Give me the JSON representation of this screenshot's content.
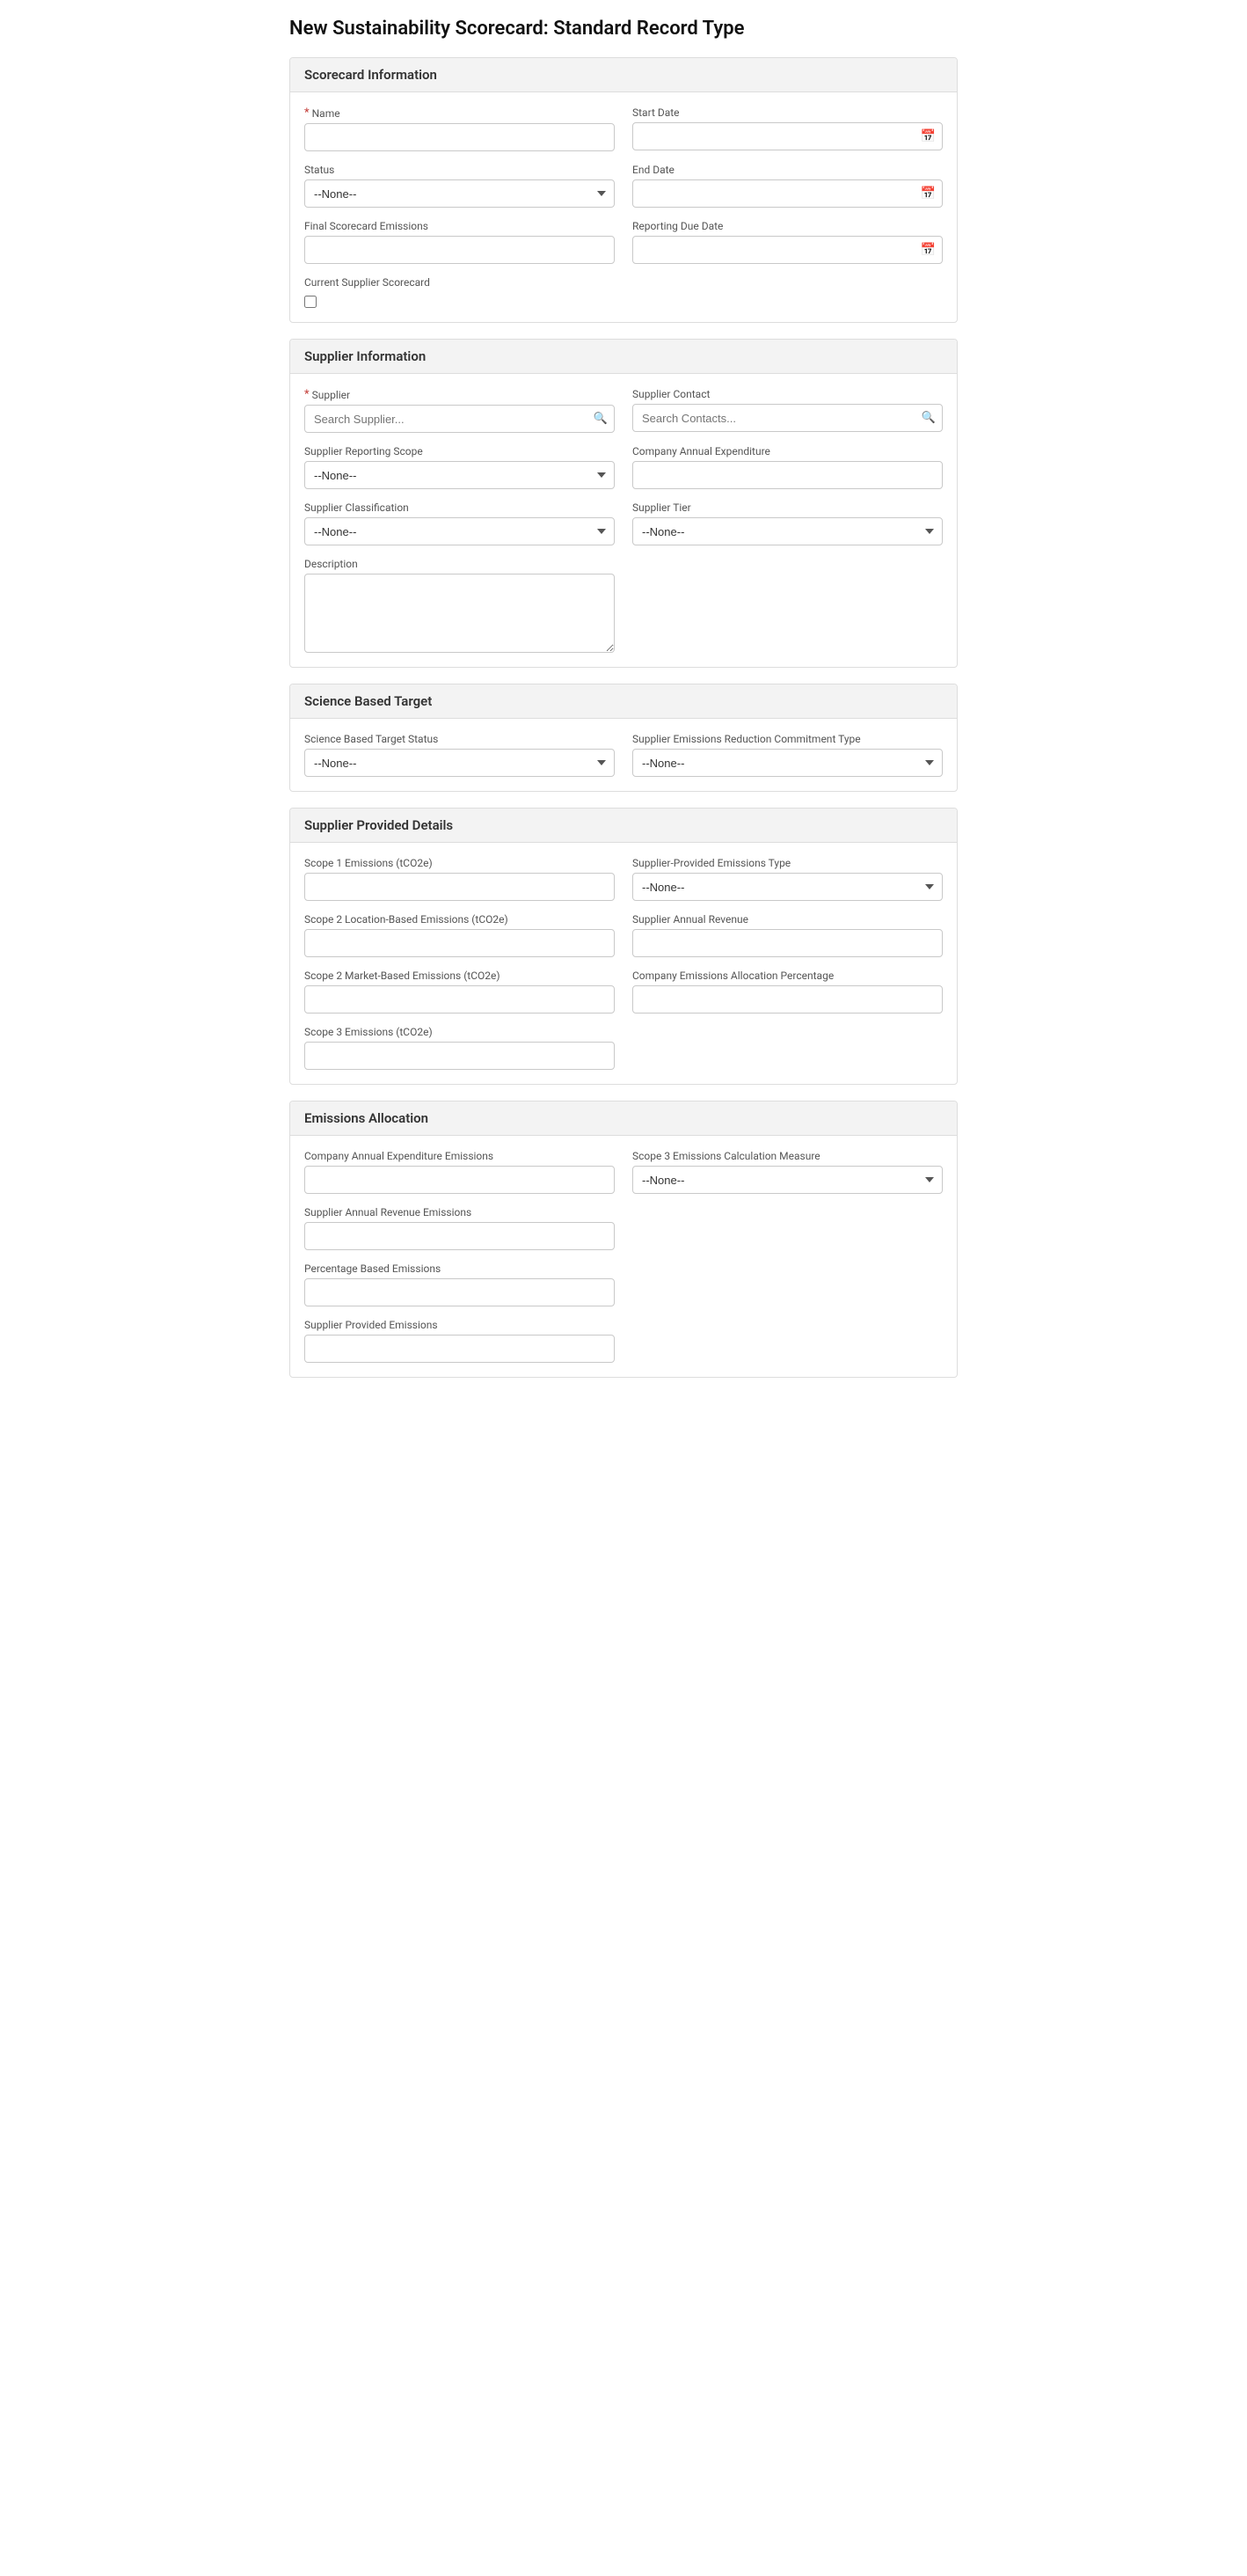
{
  "page": {
    "title": "New Sustainability Scorecard: Standard Record Type"
  },
  "sections": [
    {
      "id": "scorecard-information",
      "header": "Scorecard Information",
      "fields": [
        {
          "row": 1,
          "left": {
            "id": "name",
            "label": "Name",
            "type": "input",
            "required": true,
            "placeholder": ""
          },
          "right": {
            "id": "start-date",
            "label": "Start Date",
            "type": "date",
            "placeholder": ""
          }
        },
        {
          "row": 2,
          "left": {
            "id": "status",
            "label": "Status",
            "type": "select",
            "options": [
              "--None--"
            ],
            "value": "--None--"
          },
          "right": {
            "id": "end-date",
            "label": "End Date",
            "type": "date",
            "placeholder": ""
          }
        },
        {
          "row": 3,
          "left": {
            "id": "final-scorecard-emissions",
            "label": "Final Scorecard Emissions",
            "type": "input",
            "placeholder": ""
          },
          "right": {
            "id": "reporting-due-date",
            "label": "Reporting Due Date",
            "type": "date",
            "placeholder": ""
          }
        },
        {
          "row": 4,
          "left": {
            "id": "current-supplier-scorecard",
            "label": "Current Supplier Scorecard",
            "type": "checkbox"
          },
          "right": null
        }
      ]
    },
    {
      "id": "supplier-information",
      "header": "Supplier Information",
      "fields": [
        {
          "row": 1,
          "left": {
            "id": "supplier",
            "label": "Supplier",
            "type": "search",
            "required": true,
            "placeholder": "Search Supplier..."
          },
          "right": {
            "id": "supplier-contact",
            "label": "Supplier Contact",
            "type": "search",
            "placeholder": "Search Contacts..."
          }
        },
        {
          "row": 2,
          "left": {
            "id": "supplier-reporting-scope",
            "label": "Supplier Reporting Scope",
            "type": "select",
            "options": [
              "--None--"
            ],
            "value": "--None--"
          },
          "right": {
            "id": "company-annual-expenditure",
            "label": "Company Annual Expenditure",
            "type": "input",
            "placeholder": ""
          }
        },
        {
          "row": 3,
          "left": {
            "id": "supplier-classification",
            "label": "Supplier Classification",
            "type": "select",
            "options": [
              "--None--"
            ],
            "value": "--None--"
          },
          "right": {
            "id": "supplier-tier",
            "label": "Supplier Tier",
            "type": "select",
            "options": [
              "--None--"
            ],
            "value": "--None--"
          }
        },
        {
          "row": 4,
          "left": {
            "id": "description",
            "label": "Description",
            "type": "textarea",
            "placeholder": ""
          },
          "right": null
        }
      ]
    },
    {
      "id": "science-based-target",
      "header": "Science Based Target",
      "fields": [
        {
          "row": 1,
          "left": {
            "id": "science-based-target-status",
            "label": "Science Based Target Status",
            "type": "select",
            "options": [
              "--None--"
            ],
            "value": "--None--"
          },
          "right": {
            "id": "supplier-emissions-reduction-commitment-type",
            "label": "Supplier Emissions Reduction Commitment Type",
            "type": "select",
            "options": [
              "--None--"
            ],
            "value": "--None--"
          }
        }
      ]
    },
    {
      "id": "supplier-provided-details",
      "header": "Supplier Provided Details",
      "fields": [
        {
          "row": 1,
          "left": {
            "id": "scope-1-emissions",
            "label": "Scope 1 Emissions (tCO2e)",
            "type": "input",
            "placeholder": ""
          },
          "right": {
            "id": "supplier-provided-emissions-type",
            "label": "Supplier-Provided Emissions Type",
            "type": "select",
            "options": [
              "--None--"
            ],
            "value": "--None--"
          }
        },
        {
          "row": 2,
          "left": {
            "id": "scope-2-location-based-emissions",
            "label": "Scope 2 Location-Based Emissions (tCO2e)",
            "type": "input",
            "placeholder": ""
          },
          "right": {
            "id": "supplier-annual-revenue",
            "label": "Supplier Annual Revenue",
            "type": "input",
            "placeholder": ""
          }
        },
        {
          "row": 3,
          "left": {
            "id": "scope-2-market-based-emissions",
            "label": "Scope 2 Market-Based Emissions (tCO2e)",
            "type": "input",
            "placeholder": ""
          },
          "right": {
            "id": "company-emissions-allocation-percentage",
            "label": "Company Emissions Allocation Percentage",
            "type": "input",
            "placeholder": ""
          }
        },
        {
          "row": 4,
          "left": {
            "id": "scope-3-emissions",
            "label": "Scope 3 Emissions (tCO2e)",
            "type": "input",
            "placeholder": ""
          },
          "right": null
        }
      ]
    },
    {
      "id": "emissions-allocation",
      "header": "Emissions Allocation",
      "fields": [
        {
          "row": 1,
          "left": {
            "id": "company-annual-expenditure-emissions",
            "label": "Company Annual Expenditure Emissions",
            "type": "input",
            "placeholder": ""
          },
          "right": {
            "id": "scope-3-emissions-calculation-measure",
            "label": "Scope 3 Emissions Calculation Measure",
            "type": "select",
            "options": [
              "--None--"
            ],
            "value": "--None--"
          }
        },
        {
          "row": 2,
          "left": {
            "id": "supplier-annual-revenue-emissions",
            "label": "Supplier Annual Revenue Emissions",
            "type": "input",
            "placeholder": ""
          },
          "right": null
        },
        {
          "row": 3,
          "left": {
            "id": "percentage-based-emissions",
            "label": "Percentage Based Emissions",
            "type": "input",
            "placeholder": ""
          },
          "right": null
        },
        {
          "row": 4,
          "left": {
            "id": "supplier-provided-emissions",
            "label": "Supplier Provided Emissions",
            "type": "input",
            "placeholder": ""
          },
          "right": null
        }
      ]
    }
  ],
  "labels": {
    "none_option": "--None--",
    "search_supplier_placeholder": "Search Supplier...",
    "search_contacts_placeholder": "Search Contacts...",
    "calendar_icon": "📅",
    "search_icon": "🔍"
  }
}
